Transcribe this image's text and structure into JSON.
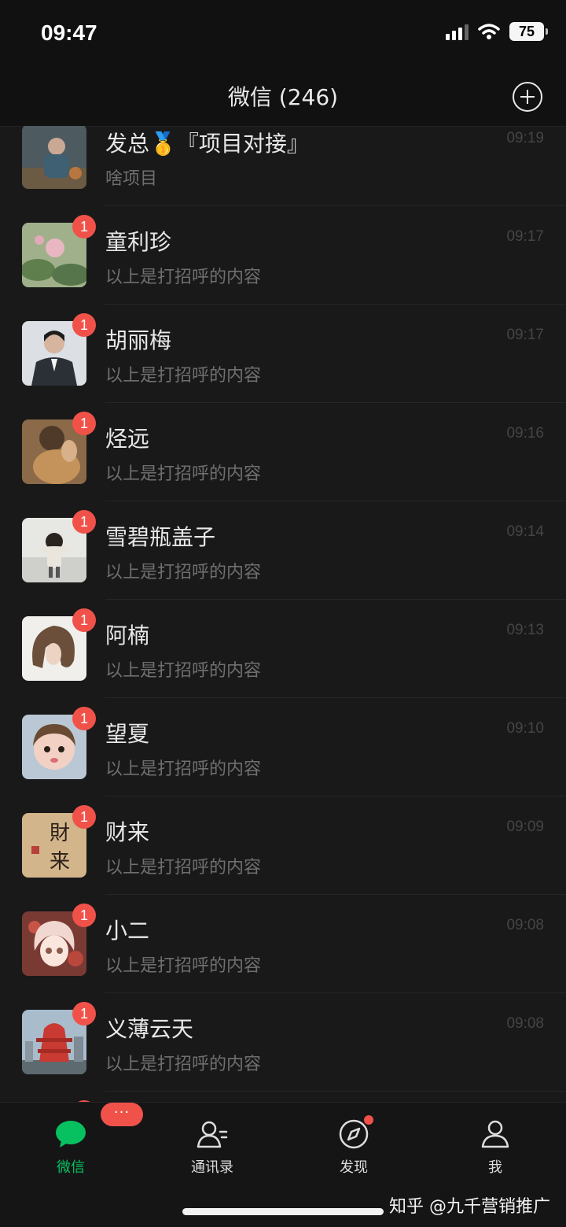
{
  "status": {
    "time": "09:47",
    "battery": "75"
  },
  "header": {
    "title": "微信 (246)",
    "add_icon": "plus-circle-icon"
  },
  "chats": [
    {
      "name": "发总🥇『项目对接』",
      "preview": "啥项目",
      "time": "09:19",
      "badge": ""
    },
    {
      "name": "童利珍",
      "preview": "以上是打招呼的内容",
      "time": "09:17",
      "badge": "1"
    },
    {
      "name": "胡丽梅",
      "preview": "以上是打招呼的内容",
      "time": "09:17",
      "badge": "1"
    },
    {
      "name": "烃远",
      "preview": "以上是打招呼的内容",
      "time": "09:16",
      "badge": "1"
    },
    {
      "name": "雪碧瓶盖子",
      "preview": "以上是打招呼的内容",
      "time": "09:14",
      "badge": "1"
    },
    {
      "name": "阿楠",
      "preview": "以上是打招呼的内容",
      "time": "09:13",
      "badge": "1"
    },
    {
      "name": "望夏",
      "preview": "以上是打招呼的内容",
      "time": "09:10",
      "badge": "1"
    },
    {
      "name": "财来",
      "preview": "以上是打招呼的内容",
      "time": "09:09",
      "badge": "1"
    },
    {
      "name": "小二",
      "preview": "以上是打招呼的内容",
      "time": "09:08",
      "badge": "1"
    },
    {
      "name": "义薄云天",
      "preview": "以上是打招呼的内容",
      "time": "09:08",
      "badge": "1"
    }
  ],
  "avatar_art": {
    "caishen_char1": "財",
    "caishen_char2": "来"
  },
  "tabs": [
    {
      "label": "微信",
      "icon": "chat-bubble-icon",
      "unread": "···"
    },
    {
      "label": "通讯录",
      "icon": "contacts-icon"
    },
    {
      "label": "发现",
      "icon": "compass-icon"
    },
    {
      "label": "我",
      "icon": "person-icon"
    }
  ],
  "colors": {
    "accent": "#07c160",
    "badge": "#f0524a",
    "background": "#191919"
  },
  "watermark": "知乎 @九千营销推广"
}
